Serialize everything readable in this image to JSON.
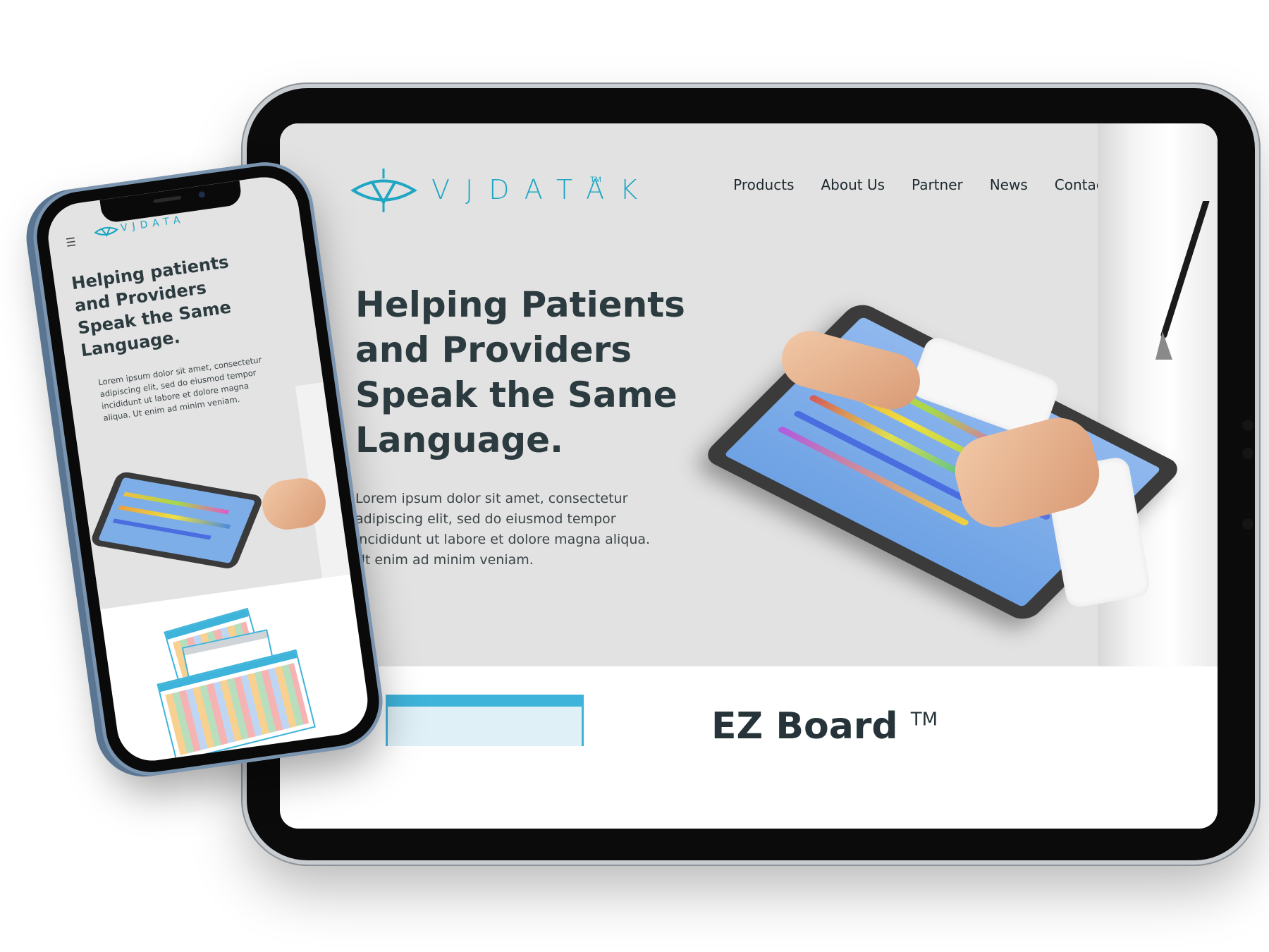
{
  "desktop": {
    "logo": {
      "text": "VJDATAK",
      "tm": "TM"
    },
    "nav": [
      "Products",
      "About Us",
      "Partner",
      "News",
      "Contact Us"
    ],
    "hero": {
      "title": "Helping Patients and Providers Speak the Same Language.",
      "body": "Lorem ipsum dolor sit amet, consectetur adipiscing elit, sed do eiusmod tempor incididunt ut labore et dolore magna aliqua. Ut enim ad minim veniam."
    },
    "product": {
      "title": "EZ Board",
      "tm": "TM"
    }
  },
  "mobile": {
    "menu_icon": "☰",
    "logo": {
      "text": "VJDATAK"
    },
    "hero": {
      "title": "Helping patients and Providers Speak the Same Language.",
      "body": "Lorem ipsum dolor sit amet, consectetur adipiscing elit, sed do eiusmod tempor incididunt ut labore et dolore magna aliqua. Ut enim ad minim veniam."
    }
  },
  "colors": {
    "brand": "#1fa6c3",
    "heading": "#2c3b3f",
    "hero_bg": "#e2e2e2",
    "card_accent": "#3eb4da"
  },
  "icons": [
    "hamburger-menu-icon",
    "vidatak-logo-mark"
  ]
}
